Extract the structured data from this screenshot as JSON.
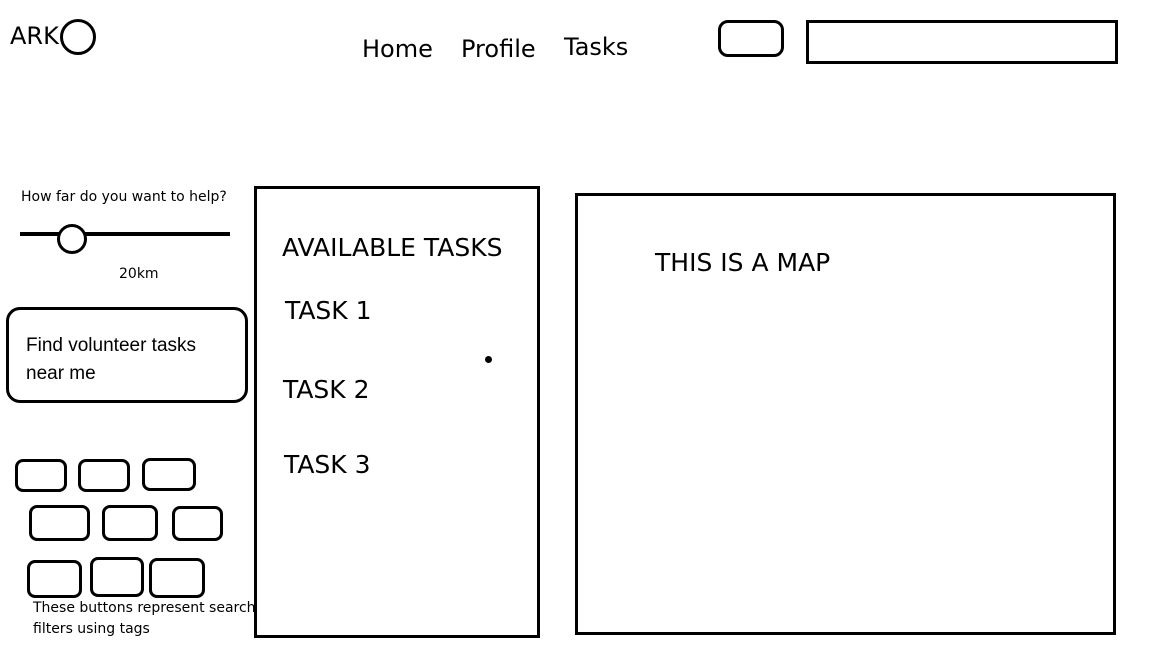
{
  "header": {
    "logo_text": "ARK",
    "nav": [
      "Home",
      "Profile",
      "Tasks"
    ],
    "search_value": ""
  },
  "distance": {
    "question": "How far do you want to help?",
    "value_label": "20km",
    "level_fraction": 0.25
  },
  "find_button": {
    "label": "Find volunteer tasks near me"
  },
  "filters": {
    "rows": [
      3,
      3,
      3
    ],
    "caption": "These buttons represent search filters using tags"
  },
  "tasks": {
    "title": "AVAILABLE TASKS",
    "items": [
      "TASK 1",
      "TASK 2",
      "TASK 3"
    ]
  },
  "map": {
    "label": "THIS IS A MAP"
  }
}
